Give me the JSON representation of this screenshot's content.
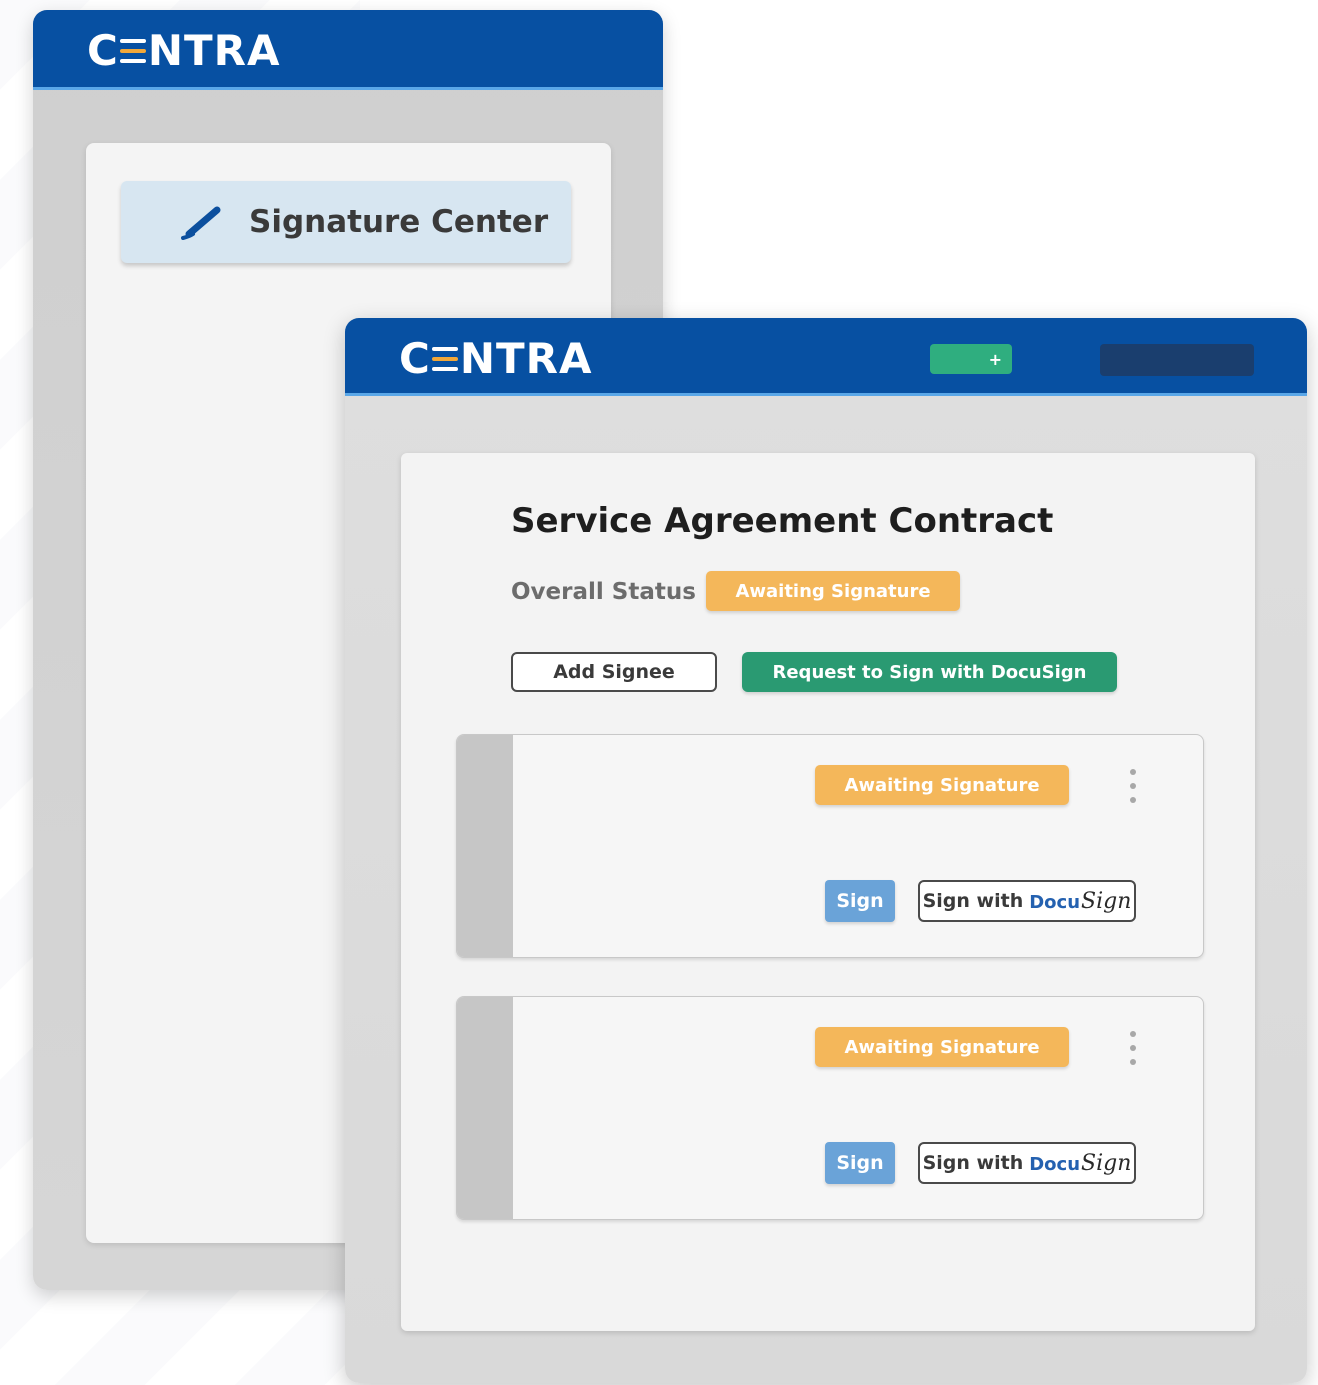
{
  "brand": {
    "logo_prefix": "C",
    "logo_suffix": "NTRA"
  },
  "back_window": {
    "nav_item": {
      "label": "Signature Center",
      "icon": "pen-icon"
    }
  },
  "front_window": {
    "header": {
      "add_button_label": "+"
    },
    "document": {
      "title": "Service Agreement Contract",
      "overall_status_label": "Overall Status",
      "overall_status_value": "Awaiting Signature",
      "add_signee_label": "Add Signee",
      "request_docusign_label": "Request to Sign with DocuSign"
    },
    "signees": [
      {
        "status": "Awaiting Signature",
        "sign_label": "Sign",
        "sign_with_label": "Sign with",
        "docu_text": "Docu",
        "sign_text": "Sign"
      },
      {
        "status": "Awaiting Signature",
        "sign_label": "Sign",
        "sign_with_label": "Sign with",
        "docu_text": "Docu",
        "sign_text": "Sign"
      }
    ]
  },
  "colors": {
    "header_blue": "#0750a2",
    "status_orange": "#f4b75a",
    "docusign_green": "#2a9a72",
    "sign_blue": "#6aa3d8"
  }
}
